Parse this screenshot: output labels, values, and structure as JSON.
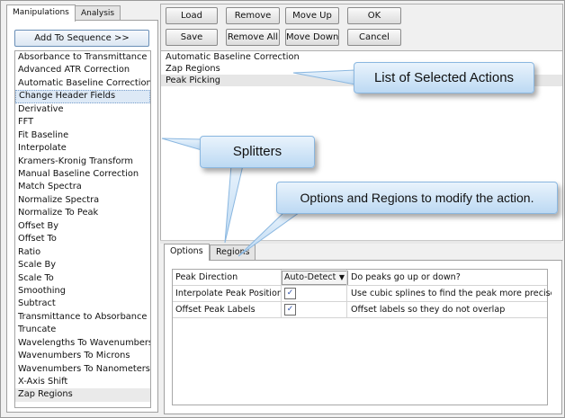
{
  "left_tabs": [
    "Manipulations",
    "Analysis"
  ],
  "add_to_sequence_label": "Add To Sequence >>",
  "manipulations": [
    "Absorbance to Transmittance",
    "Advanced ATR Correction",
    "Automatic Baseline Correction",
    "Change Header Fields",
    "Derivative",
    "FFT",
    "Fit Baseline",
    "Interpolate",
    "Kramers-Kronig Transform",
    "Manual Baseline Correction",
    "Match Spectra",
    "Normalize Spectra",
    "Normalize To Peak",
    "Offset By",
    "Offset To",
    "Ratio",
    "Scale By",
    "Scale To",
    "Smoothing",
    "Subtract",
    "Transmittance to Absorbance",
    "Truncate",
    "Wavelengths To Wavenumbers",
    "Wavenumbers To Microns",
    "Wavenumbers To Nanometers",
    "X-Axis Shift",
    "Zap Regions"
  ],
  "toolbar": {
    "load": "Load",
    "remove": "Remove",
    "move_up": "Move Up",
    "ok": "OK",
    "save": "Save",
    "remove_all": "Remove All",
    "move_down": "Move Down",
    "cancel": "Cancel"
  },
  "selected_actions": [
    "Automatic Baseline Correction",
    "Zap Regions",
    "Peak Picking"
  ],
  "bottom_tabs": [
    "Options",
    "Regions"
  ],
  "options": [
    {
      "name": "Peak Direction",
      "value": "Auto-Detect",
      "description": "Do peaks go up or down?"
    },
    {
      "name": "Interpolate Peak Positions",
      "checked": "✓",
      "description": "Use cubic splines to find the peak more precisely"
    },
    {
      "name": "Offset Peak Labels",
      "checked": "✓",
      "description": "Offset labels so they do not overlap"
    }
  ],
  "callouts": {
    "selected_actions": "List of Selected Actions",
    "splitters": "Splitters",
    "options_regions": "Options and Regions to modify the action."
  }
}
